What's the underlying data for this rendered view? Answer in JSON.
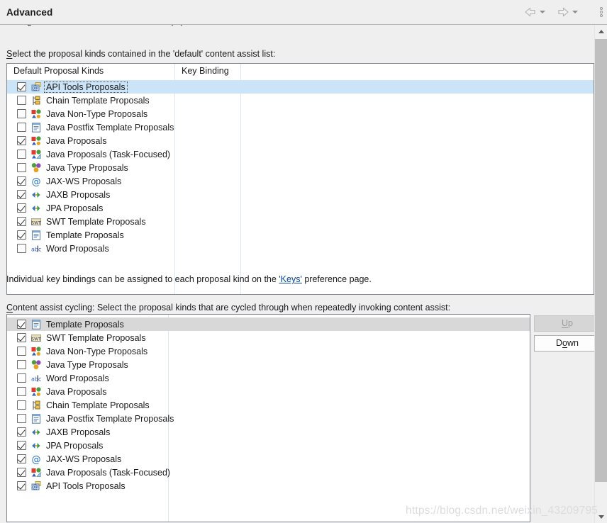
{
  "window": {
    "title": "Advanced",
    "nav": {
      "back_icon": "back-arrow-icon",
      "back_caret_icon": "chevron-down-icon",
      "forward_icon": "forward-arrow-icon",
      "forward_caret_icon": "chevron-down-icon",
      "menu_icon": "vertical-dots-menu-icon"
    }
  },
  "clipped_top": {
    "fragment_left": "g",
    "fragment_right": "( . )"
  },
  "default_section": {
    "label_mnemonic": "S",
    "label_rest": "elect the proposal kinds contained in the 'default' content assist list:",
    "columns": [
      "Default Proposal Kinds",
      "Key Binding"
    ],
    "rows": [
      {
        "label": "API Tools Proposals",
        "checked": true,
        "icon": "api-tools-icon",
        "selected": "focus"
      },
      {
        "label": "Chain Template Proposals",
        "checked": false,
        "icon": "chain-template-icon",
        "selected": "none"
      },
      {
        "label": "Java Non-Type Proposals",
        "checked": false,
        "icon": "java-nontype-icon",
        "selected": "none"
      },
      {
        "label": "Java Postfix Template Proposals",
        "checked": false,
        "icon": "template-doc-icon",
        "selected": "none"
      },
      {
        "label": "Java Proposals",
        "checked": true,
        "icon": "java-nontype-icon",
        "selected": "none"
      },
      {
        "label": "Java Proposals (Task-Focused)",
        "checked": false,
        "icon": "java-task-icon",
        "selected": "none"
      },
      {
        "label": "Java Type Proposals",
        "checked": false,
        "icon": "java-type-icon",
        "selected": "none"
      },
      {
        "label": "JAX-WS Proposals",
        "checked": true,
        "icon": "at-sign-icon",
        "selected": "none"
      },
      {
        "label": "JAXB Proposals",
        "checked": true,
        "icon": "double-arrow-icon",
        "selected": "none"
      },
      {
        "label": "JPA Proposals",
        "checked": true,
        "icon": "double-arrow-icon",
        "selected": "none"
      },
      {
        "label": "SWT Template Proposals",
        "checked": true,
        "icon": "swt-template-icon",
        "selected": "none"
      },
      {
        "label": "Template Proposals",
        "checked": true,
        "icon": "template-doc-icon",
        "selected": "none"
      },
      {
        "label": "Word Proposals",
        "checked": false,
        "icon": "abc-word-icon",
        "selected": "none"
      }
    ]
  },
  "keys_note": {
    "before": "Individual key bindings can be assigned to each proposal kind on the ",
    "link": "'Keys'",
    "after": " preference page."
  },
  "cycling_section": {
    "label_mnemonic": "C",
    "label_rest": "ontent assist cycling: Select the proposal kinds that are cycled through when repeatedly invoking content assist:",
    "rows": [
      {
        "label": "Template Proposals",
        "checked": true,
        "icon": "template-doc-icon",
        "selected": "gray"
      },
      {
        "label": "SWT Template Proposals",
        "checked": true,
        "icon": "swt-template-icon",
        "selected": "none"
      },
      {
        "label": "Java Non-Type Proposals",
        "checked": false,
        "icon": "java-nontype-icon",
        "selected": "none"
      },
      {
        "label": "Java Type Proposals",
        "checked": false,
        "icon": "java-type-icon",
        "selected": "none"
      },
      {
        "label": "Word Proposals",
        "checked": false,
        "icon": "abc-word-icon",
        "selected": "none"
      },
      {
        "label": "Java Proposals",
        "checked": false,
        "icon": "java-nontype-icon",
        "selected": "none"
      },
      {
        "label": "Chain Template Proposals",
        "checked": false,
        "icon": "chain-template-icon",
        "selected": "none"
      },
      {
        "label": "Java Postfix Template Proposals",
        "checked": false,
        "icon": "template-doc-icon",
        "selected": "none"
      },
      {
        "label": "JAXB Proposals",
        "checked": true,
        "icon": "double-arrow-icon",
        "selected": "none"
      },
      {
        "label": "JPA Proposals",
        "checked": true,
        "icon": "double-arrow-icon",
        "selected": "none"
      },
      {
        "label": "JAX-WS Proposals",
        "checked": true,
        "icon": "at-sign-icon",
        "selected": "none"
      },
      {
        "label": "Java Proposals (Task-Focused)",
        "checked": true,
        "icon": "java-task-icon",
        "selected": "none"
      },
      {
        "label": "API Tools Proposals",
        "checked": true,
        "icon": "api-tools-icon",
        "selected": "none"
      }
    ],
    "buttons": {
      "up": {
        "mnemonic": "U",
        "rest": "p",
        "enabled": false
      },
      "down": {
        "pre": "D",
        "mnemonic": "o",
        "rest": "wn",
        "enabled": true
      }
    }
  },
  "scrollbar": {
    "up_icon": "scroll-up-arrow-icon",
    "down_icon": "scroll-down-arrow-icon",
    "thumb": "scrollbar-thumb"
  },
  "watermark": "https://blog.csdn.net/weixin_43209795",
  "colors": {
    "selection_focus": "#cce4f7",
    "selection_inactive": "#d8d8d8",
    "link": "#0b46a0",
    "panel": "#efefef",
    "border": "#828790"
  }
}
